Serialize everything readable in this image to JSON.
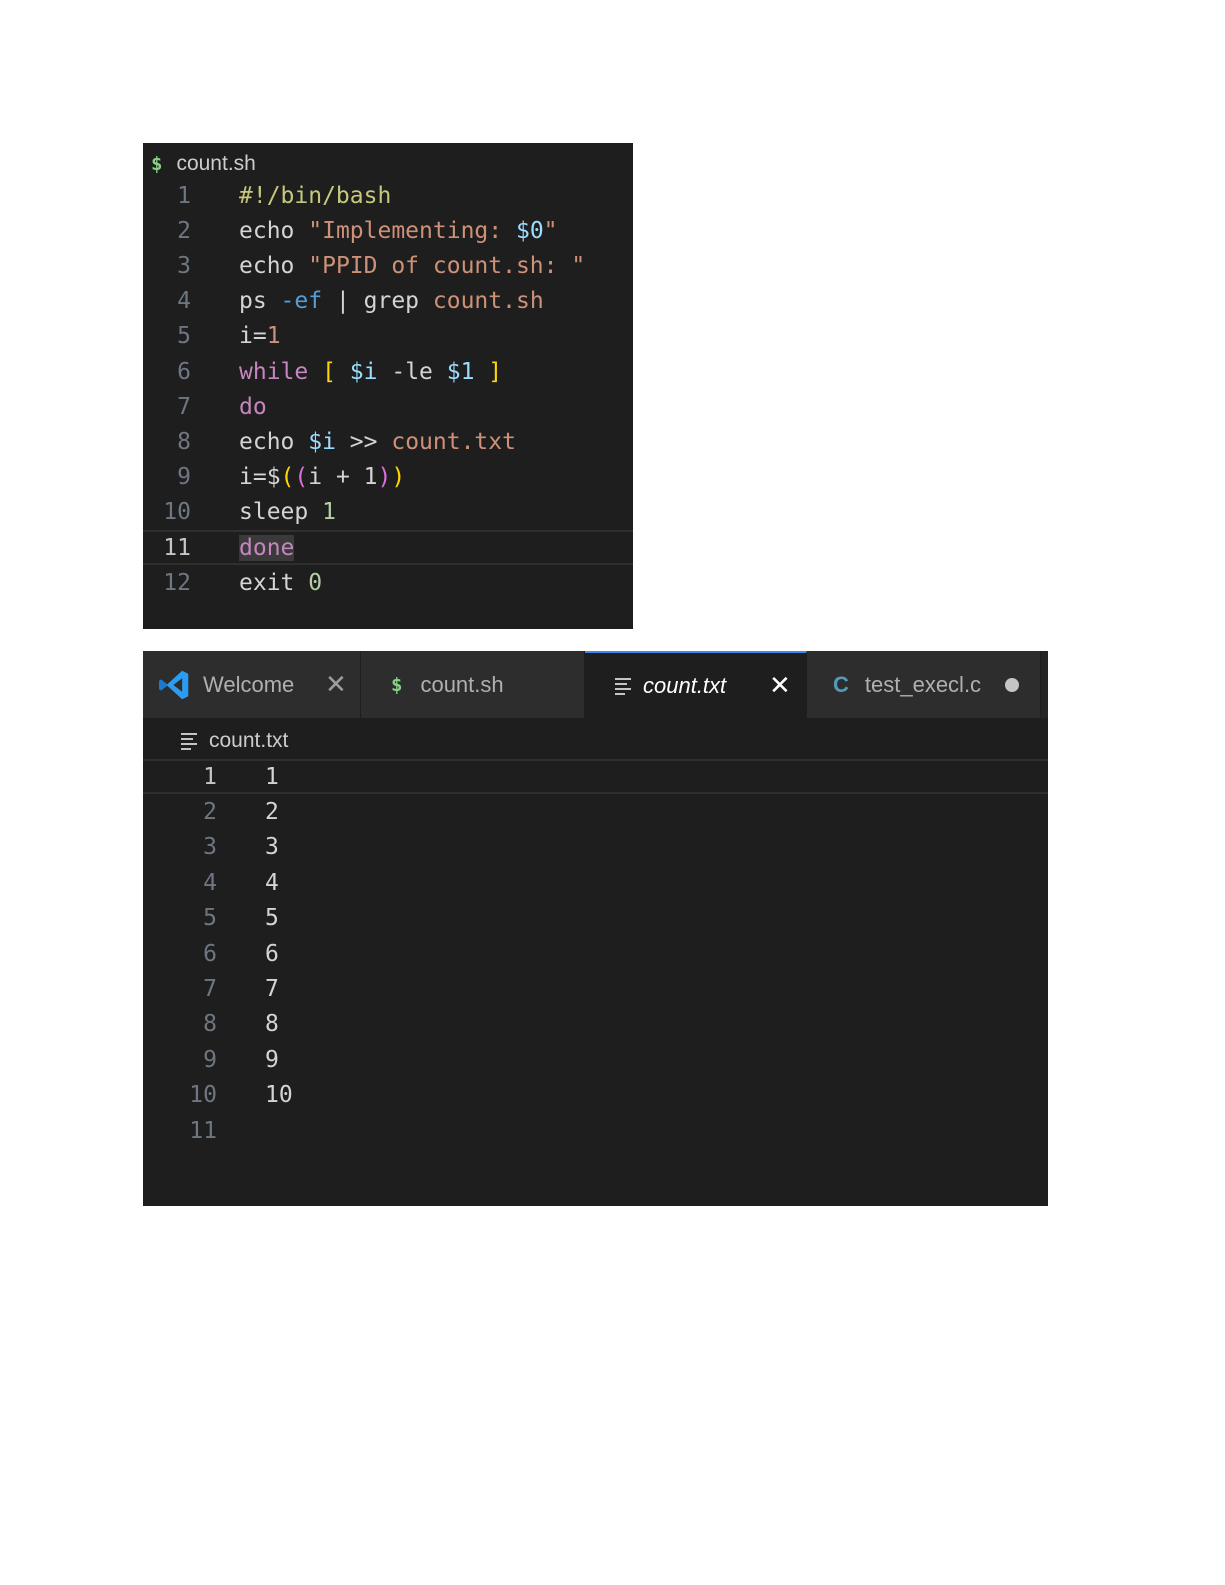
{
  "sh_panel": {
    "breadcrumb": "count.sh",
    "icon": "dollar-sign-icon",
    "current_line": 11,
    "lines": [
      {
        "n": "1",
        "tokens": [
          {
            "t": "#!/bin/bash",
            "c": "cmt"
          }
        ]
      },
      {
        "n": "2",
        "tokens": [
          {
            "t": "echo ",
            "c": "plain"
          },
          {
            "t": "\"Implementing: ",
            "c": "str"
          },
          {
            "t": "$0",
            "c": "var"
          },
          {
            "t": "\"",
            "c": "str"
          }
        ]
      },
      {
        "n": "3",
        "tokens": [
          {
            "t": "echo ",
            "c": "plain"
          },
          {
            "t": "\"PPID of count.sh: \"",
            "c": "str"
          }
        ]
      },
      {
        "n": "4",
        "tokens": [
          {
            "t": "ps ",
            "c": "plain"
          },
          {
            "t": "-ef",
            "c": "opt"
          },
          {
            "t": " | ",
            "c": "plain"
          },
          {
            "t": "grep ",
            "c": "plain"
          },
          {
            "t": "count.sh",
            "c": "str"
          }
        ]
      },
      {
        "n": "5",
        "tokens": [
          {
            "t": "i",
            "c": "plain"
          },
          {
            "t": "=",
            "c": "op"
          },
          {
            "t": "1",
            "c": "str"
          }
        ]
      },
      {
        "n": "6",
        "tokens": [
          {
            "t": "while ",
            "c": "kw"
          },
          {
            "t": "[ ",
            "c": "br1"
          },
          {
            "t": "$i",
            "c": "var"
          },
          {
            "t": " -le ",
            "c": "plain"
          },
          {
            "t": "$1",
            "c": "var"
          },
          {
            "t": " ]",
            "c": "br1"
          }
        ]
      },
      {
        "n": "7",
        "tokens": [
          {
            "t": "do",
            "c": "kw"
          }
        ]
      },
      {
        "n": "8",
        "tokens": [
          {
            "t": "echo ",
            "c": "plain"
          },
          {
            "t": "$i",
            "c": "var"
          },
          {
            "t": " >> ",
            "c": "plain"
          },
          {
            "t": "count.txt",
            "c": "str"
          }
        ]
      },
      {
        "n": "9",
        "tokens": [
          {
            "t": "i=$",
            "c": "plain"
          },
          {
            "t": "(",
            "c": "br1"
          },
          {
            "t": "(",
            "c": "br2"
          },
          {
            "t": "i + 1",
            "c": "plain"
          },
          {
            "t": ")",
            "c": "br2"
          },
          {
            "t": ")",
            "c": "br1"
          }
        ]
      },
      {
        "n": "10",
        "tokens": [
          {
            "t": "sleep ",
            "c": "plain"
          },
          {
            "t": "1",
            "c": "num"
          }
        ]
      },
      {
        "n": "11",
        "tokens": [
          {
            "t": "done",
            "c": "kw",
            "hl": true
          }
        ]
      },
      {
        "n": "12",
        "tokens": [
          {
            "t": "exit ",
            "c": "plain"
          },
          {
            "t": "0",
            "c": "num"
          }
        ]
      }
    ]
  },
  "tabs": [
    {
      "label": "Welcome",
      "icon": "vscode-logo-icon",
      "close": "✕",
      "active": false
    },
    {
      "label": "count.sh",
      "icon": "dollar-sign-icon",
      "active": false
    },
    {
      "label": "count.txt",
      "icon": "text-lines-icon",
      "close": "✕",
      "active": true
    },
    {
      "label": "test_execl.c",
      "icon": "c-language-icon",
      "modified": true,
      "active": false
    }
  ],
  "txt_panel": {
    "breadcrumb": "count.txt",
    "icon": "text-lines-icon",
    "current_line": 1,
    "lines": [
      {
        "n": "1",
        "text": "1"
      },
      {
        "n": "2",
        "text": "2"
      },
      {
        "n": "3",
        "text": "3"
      },
      {
        "n": "4",
        "text": "4"
      },
      {
        "n": "5",
        "text": "5"
      },
      {
        "n": "6",
        "text": "6"
      },
      {
        "n": "7",
        "text": "7"
      },
      {
        "n": "8",
        "text": "8"
      },
      {
        "n": "9",
        "text": "9"
      },
      {
        "n": "10",
        "text": "10"
      },
      {
        "n": "11",
        "text": ""
      }
    ]
  },
  "colors": {
    "editor_bg": "#1e1e1e",
    "tab_active_border": "#3c8ce7",
    "dollar_icon": "#89d185",
    "c_icon": "#519aba"
  }
}
